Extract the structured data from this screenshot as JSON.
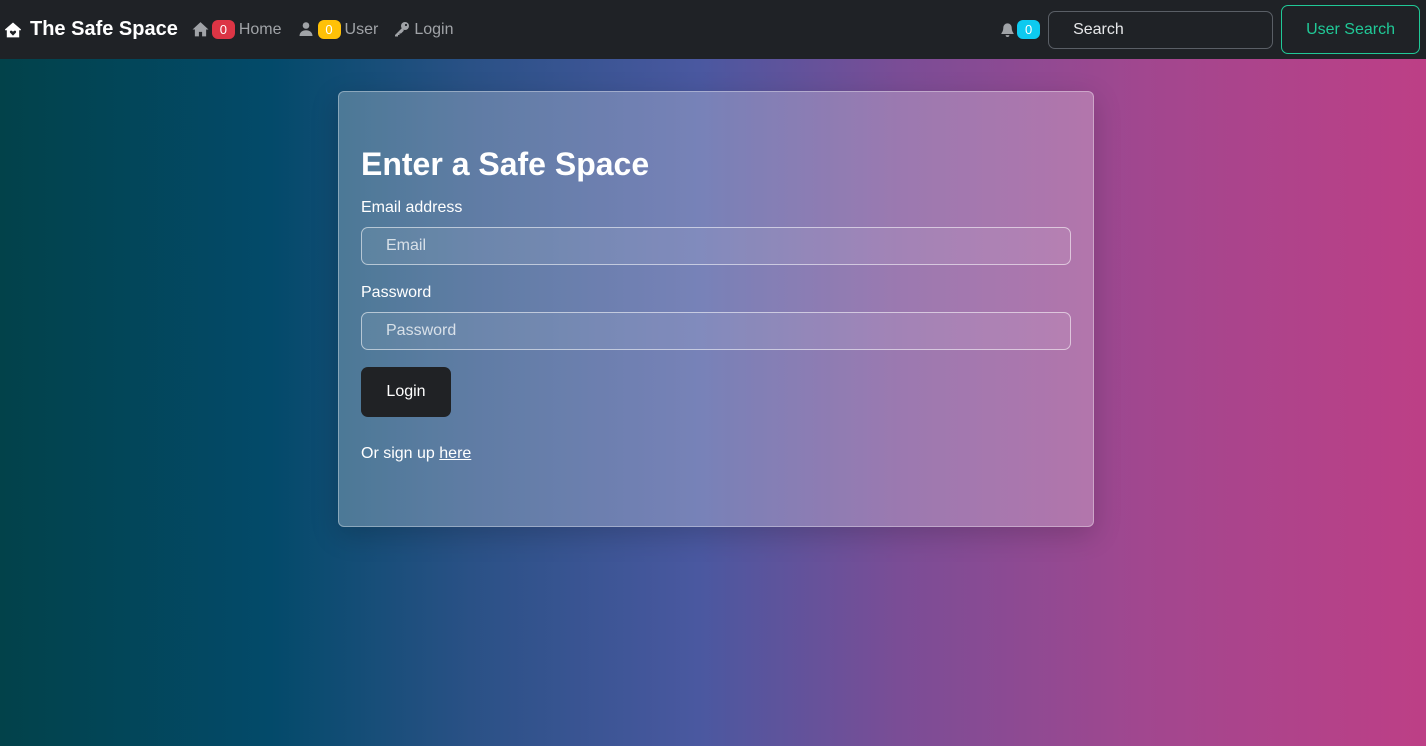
{
  "navbar": {
    "brand": "The Safe Space",
    "links": [
      {
        "icon": "house-icon",
        "badge": "0",
        "badge_color": "#dc3545",
        "label": "Home"
      },
      {
        "icon": "person-icon",
        "badge": "0",
        "badge_color": "#ffc107",
        "label": "User"
      },
      {
        "icon": "key-icon",
        "label": "Login"
      }
    ],
    "notifications": {
      "icon": "bell-icon",
      "badge": "0",
      "badge_color": "#0dcaf0"
    },
    "search_placeholder": "Search",
    "user_search_label": "User Search"
  },
  "form": {
    "title": "Enter a Safe Space",
    "email_label": "Email address",
    "email_placeholder": "Email",
    "password_label": "Password",
    "password_placeholder": "Password",
    "submit_label": "Login",
    "signup_text": "Or sign up ",
    "signup_link": "here"
  },
  "colors": {
    "accent": "#20c997",
    "navbar_bg": "#1f2226"
  }
}
